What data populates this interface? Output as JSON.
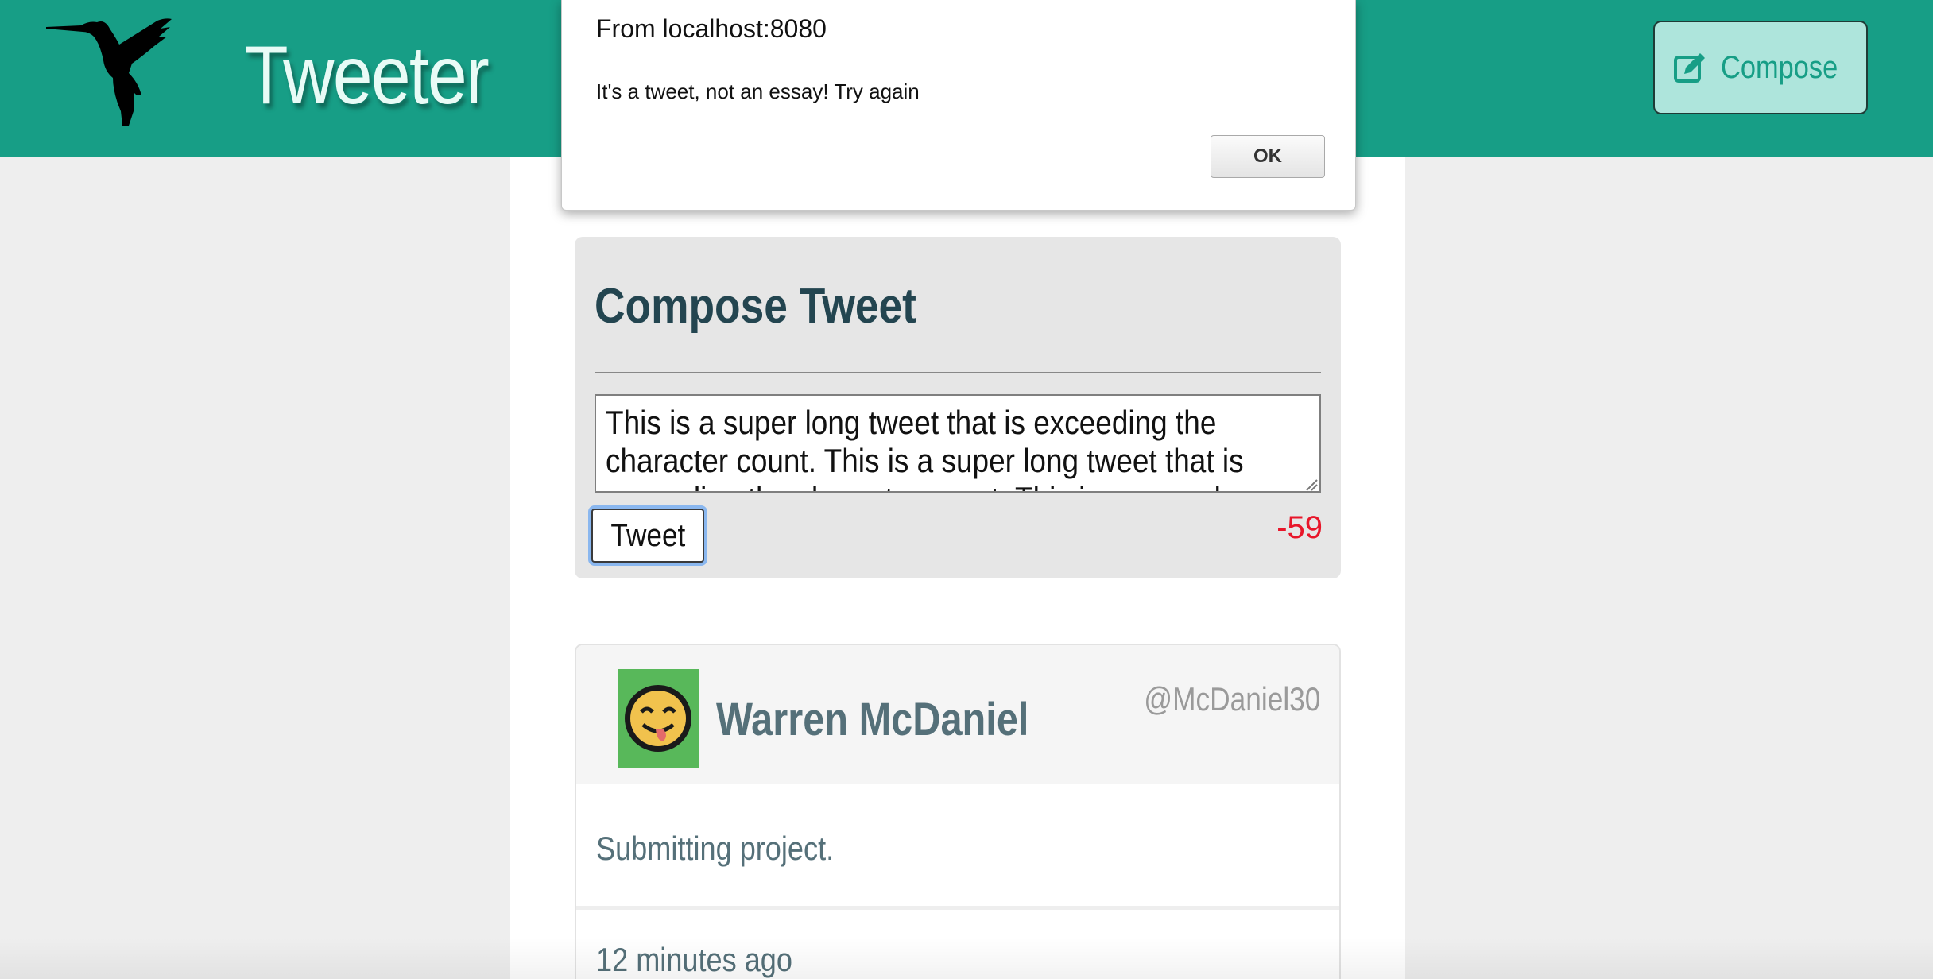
{
  "navbar": {
    "brand": "Tweeter",
    "logo_icon": "hummingbird-icon",
    "compose_button": {
      "icon": "edit-icon",
      "label": "Compose"
    }
  },
  "alert": {
    "origin": "From localhost:8080",
    "message": "It's a tweet, not an essay! Try again",
    "ok_label": "OK"
  },
  "compose": {
    "title": "Compose Tweet",
    "textarea_value": "This is a super long tweet that is exceeding the character count. This is a super long tweet that is exceeding the character count. This is a super long",
    "submit_label": "Tweet",
    "counter": "-59"
  },
  "tweet": {
    "avatar_icon": "emoji-avatar-icon",
    "name": "Warren McDaniel",
    "handle": "@McDaniel30",
    "body": "Submitting project.",
    "time": "12 minutes ago"
  },
  "colors": {
    "nav_green": "#179e86",
    "counter_red": "#e8162a",
    "heading_dark": "#234550",
    "text_slate": "#557079"
  }
}
